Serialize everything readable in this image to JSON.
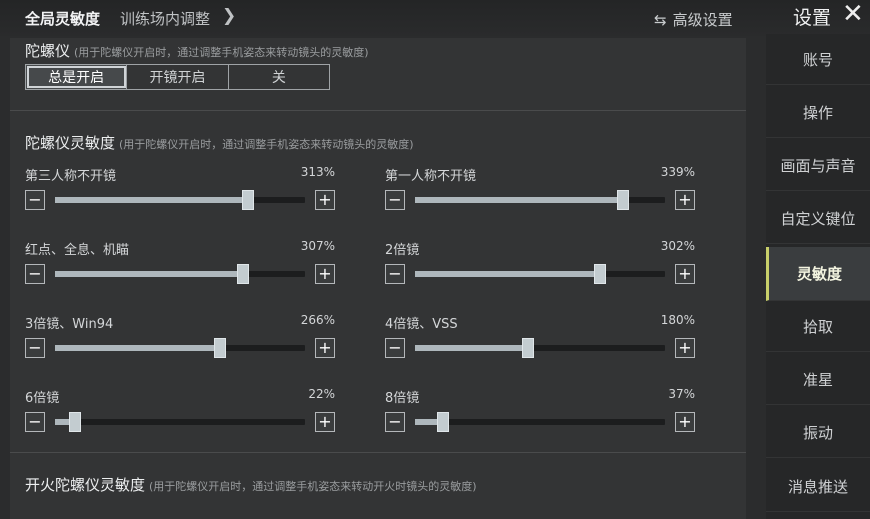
{
  "header": {
    "tab_global": "全局灵敏度",
    "tab_training": "训练场内调整",
    "advanced_label": "高级设置",
    "settings_title": "设置"
  },
  "gyro": {
    "title": "陀螺仪",
    "hint": "(用于陀螺仪开启时，通过调整手机姿态来转动镜头的灵敏度)",
    "options": [
      "总是开启",
      "开镜开启",
      "关"
    ],
    "selected": 0
  },
  "gyro_sensitivity": {
    "title": "陀螺仪灵敏度",
    "hint": "(用于陀螺仪开启时，通过调整手机姿态来转动镜头的灵敏度)",
    "sliders": [
      {
        "label": "第三人称不开镜",
        "value": "313%",
        "level": 0.77
      },
      {
        "label": "第一人称不开镜",
        "value": "339%",
        "level": 0.83
      },
      {
        "label": "红点、全息、机瞄",
        "value": "307%",
        "level": 0.75
      },
      {
        "label": "2倍镜",
        "value": "302%",
        "level": 0.74
      },
      {
        "label": "3倍镜、Win94",
        "value": "266%",
        "level": 0.66
      },
      {
        "label": "4倍镜、VSS",
        "value": "180%",
        "level": 0.45
      },
      {
        "label": "6倍镜",
        "value": "22%",
        "level": 0.08
      },
      {
        "label": "8倍镜",
        "value": "37%",
        "level": 0.11
      }
    ]
  },
  "fire_gyro": {
    "title": "开火陀螺仪灵敏度",
    "hint": "(用于陀螺仪开启时，通过调整手机姿态来转动开火时镜头的灵敏度)"
  },
  "sidebar": {
    "items": [
      "账号",
      "操作",
      "画面与声音",
      "自定义键位",
      "灵敏度",
      "拾取",
      "准星",
      "振动",
      "消息推送"
    ],
    "active": 4
  },
  "colors": {
    "accent": "#c8cf6a",
    "slider_fill": "#aeb7bc"
  }
}
